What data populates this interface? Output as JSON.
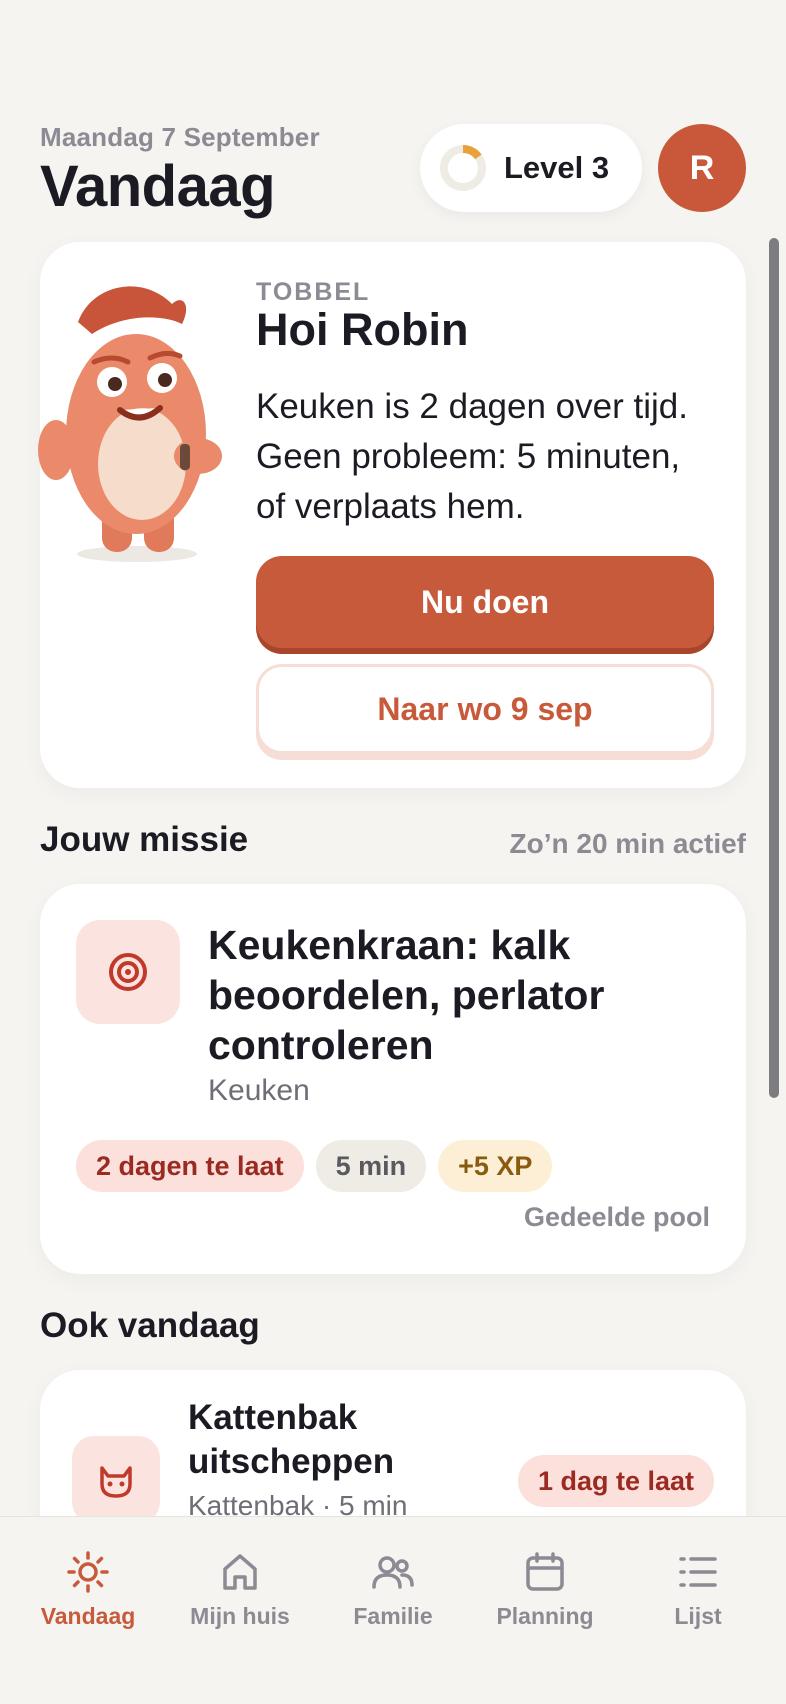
{
  "header": {
    "date": "Maandag 7 September",
    "title": "Vandaag",
    "level_label": "Level 3",
    "level_progress": 0.15,
    "avatar_initial": "R"
  },
  "tobbel": {
    "label": "TOBBEL",
    "greeting": "Hoi Robin",
    "message": "Keuken is 2 dagen over tijd. Geen probleem: 5 minuten, of verplaats hem.",
    "primary_button": "Nu doen",
    "secondary_button": "Naar wo 9 sep"
  },
  "mission": {
    "section_title": "Jouw missie",
    "section_sub": "Zo’n 20 min actief",
    "title": "Keukenkraan: kalk beoordelen, perlator controleren",
    "room": "Keuken",
    "tags": [
      "2 dagen te laat",
      "5 min",
      "+5 XP"
    ],
    "pool": "Gedeelde pool"
  },
  "also_today": {
    "section_title": "Ook vandaag",
    "items": [
      {
        "title": "Kattenbak uitscheppen",
        "meta": "Kattenbak · 5 min",
        "tag": "1 dag te laat"
      }
    ]
  },
  "tabbar": {
    "items": [
      {
        "label": "Vandaag",
        "icon": "sun-icon",
        "active": true
      },
      {
        "label": "Mijn huis",
        "icon": "home-icon",
        "active": false
      },
      {
        "label": "Familie",
        "icon": "people-icon",
        "active": false
      },
      {
        "label": "Planning",
        "icon": "calendar-icon",
        "active": false
      },
      {
        "label": "Lijst",
        "icon": "list-icon",
        "active": false
      }
    ]
  },
  "colors": {
    "accent": "#c85a3c",
    "background": "#f6f4f0",
    "late_bg": "#fbe0dc",
    "xp_bg": "#fcefd5"
  }
}
